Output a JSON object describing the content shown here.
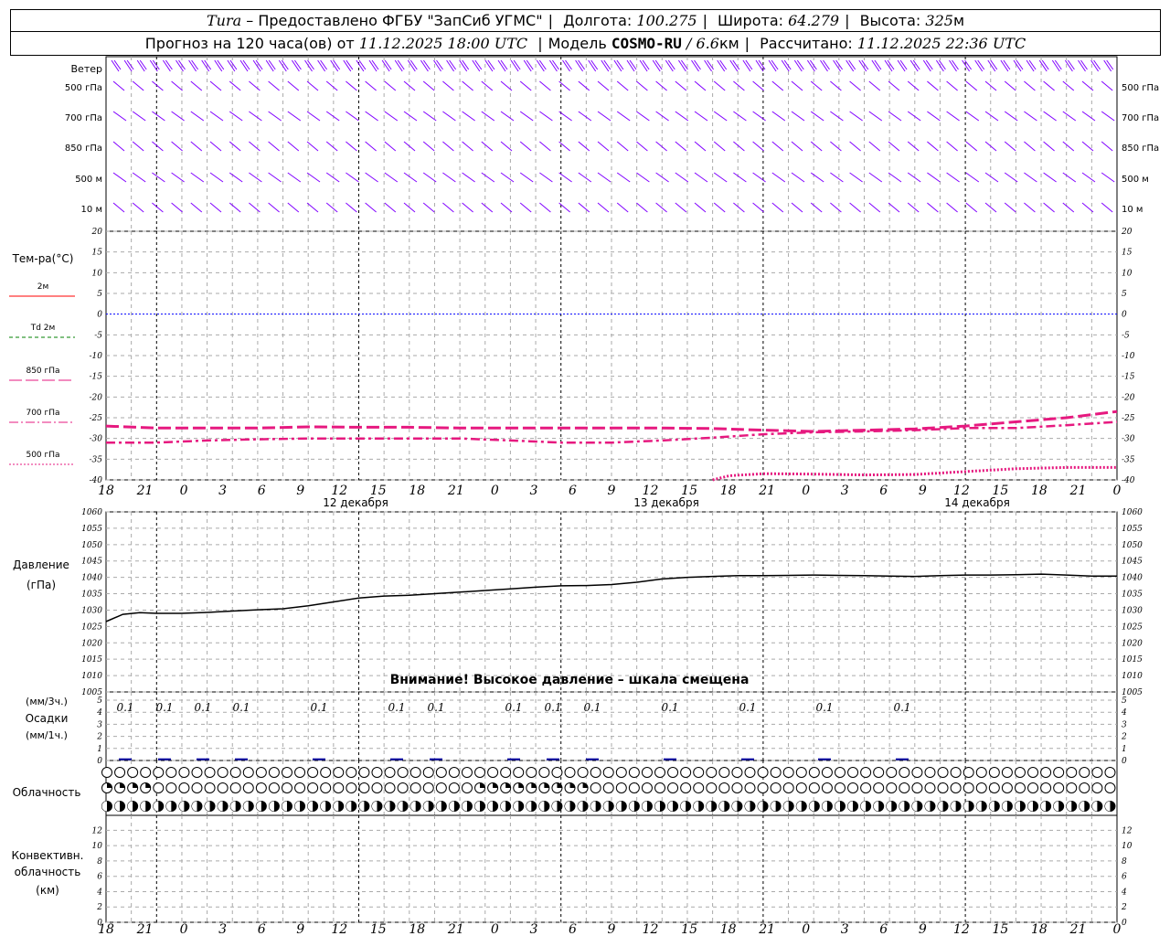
{
  "header": {
    "station": "Tura",
    "provided_by": "– Предоставлено ФГБУ \"ЗапСиб УГМС\"",
    "lon_label": "Долгота:",
    "lon": "100.275",
    "lat_label": "Широта:",
    "lat": "64.279",
    "alt_label": "Высота:",
    "alt": "325",
    "alt_unit": "м",
    "forecast_label": "Прогноз на 120 часа(ов) от",
    "forecast_start": "11.12.2025 18:00 UTC",
    "model_label": "Модель",
    "model": "COSMO-RU",
    "model_res": "/ 6.6",
    "model_res_unit": "км",
    "computed_label": "Рассчитано:",
    "computed": "11.12.2025 22:36 UTC"
  },
  "colors": {
    "t2m": "#ff0000",
    "td2m": "#008000",
    "series_magenta": "#e6197f",
    "wind": "#8000ff",
    "zero_line": "#0000ff",
    "pressure": "#000000",
    "precip": "#0000a0",
    "grid": "#aaaaaa"
  },
  "wind_panel": {
    "title": "Ветер",
    "levels": [
      "500 гПа",
      "700 гПа",
      "850 гПа",
      "500 м",
      "10 м"
    ]
  },
  "time_axis": {
    "ticks": [
      "18",
      "21",
      "0",
      "3",
      "6",
      "9",
      "12",
      "15",
      "18",
      "21",
      "0",
      "3",
      "6",
      "9",
      "12",
      "15",
      "18",
      "21",
      "0",
      "3",
      "6",
      "9",
      "12",
      "15",
      "18",
      "21",
      "0"
    ],
    "day_labels": [
      "12 декабря",
      "13 декабря",
      "14 декабря"
    ]
  },
  "temp_panel": {
    "title": "Тем-ра(°С)",
    "legend": [
      {
        "label": "2м",
        "style": "solid",
        "color": "#ff0000"
      },
      {
        "label": "Td 2м",
        "style": "dashed",
        "color": "#008000"
      },
      {
        "label": "850 гПа",
        "style": "longdash",
        "color": "#e6197f"
      },
      {
        "label": "700 гПа",
        "style": "dashdot",
        "color": "#e6197f"
      },
      {
        "label": "500 гПа",
        "style": "dotted",
        "color": "#e6197f"
      }
    ],
    "yticks": [
      "20",
      "15",
      "10",
      "5",
      "0",
      "-5",
      "-10",
      "-15",
      "-20",
      "-25",
      "-30",
      "-35",
      "-40"
    ]
  },
  "pressure_panel": {
    "title_line1": "Давление",
    "title_line2": "(гПа)",
    "warning": "Внимание! Высокое давление – шкала смещена",
    "yticks": [
      "1060",
      "1055",
      "1050",
      "1045",
      "1040",
      "1035",
      "1030",
      "1025",
      "1020",
      "1015",
      "1010",
      "1005"
    ]
  },
  "precip_panel": {
    "title_line1": "(мм/3ч.)",
    "title_line2": "Осадки",
    "title_line3": "(мм/1ч.)",
    "yticks": [
      "5",
      "4",
      "3",
      "2",
      "1",
      "0"
    ],
    "labels": [
      "0.1",
      "0.1",
      "0.1",
      "0.1",
      "0.1",
      "0.1",
      "0.1",
      "0.1",
      "0.1",
      "0.1",
      "0.1",
      "0.1",
      "0.1",
      "0.1"
    ]
  },
  "cloud_panel": {
    "title": "Облачность"
  },
  "conv_panel": {
    "title_line1": "Конвективн.",
    "title_line2": "облачность",
    "title_line3": "(км)",
    "yticks": [
      "12",
      "10",
      "8",
      "6",
      "4",
      "2",
      "0"
    ]
  },
  "chart_data": [
    {
      "type": "line",
      "title": "Тем-ра(°С)",
      "x_unit": "hours from forecast start",
      "ylim": [
        -40,
        20
      ],
      "series": [
        {
          "name": "850 гПа",
          "x": [
            0,
            6,
            12,
            18,
            24,
            30,
            36,
            42,
            48,
            54,
            60,
            66,
            72,
            78,
            84,
            90,
            96,
            102,
            108,
            114,
            120
          ],
          "values": [
            -27,
            -27.5,
            -27.5,
            -27.5,
            -27.2,
            -27.3,
            -27.3,
            -27.5,
            -27.5,
            -27.5,
            -27.5,
            -27.5,
            -27.6,
            -28,
            -28.3,
            -28,
            -27.7,
            -27,
            -26,
            -25,
            -23.5
          ]
        },
        {
          "name": "700 гПа",
          "x": [
            0,
            6,
            12,
            18,
            24,
            30,
            36,
            42,
            48,
            54,
            60,
            66,
            72,
            78,
            84,
            90,
            96,
            102,
            108,
            114,
            120
          ],
          "values": [
            -31,
            -31,
            -30.5,
            -30.2,
            -30,
            -30,
            -30,
            -30,
            -30.5,
            -31,
            -31,
            -30.5,
            -29.8,
            -29,
            -28.5,
            -28.3,
            -28,
            -27.5,
            -27.5,
            -26.8,
            -26
          ]
        },
        {
          "name": "500 гПа",
          "x": [
            72,
            74,
            78,
            84,
            90,
            96,
            102,
            108,
            114,
            120
          ],
          "values": [
            -40,
            -39,
            -38.5,
            -38.6,
            -38.8,
            -38.7,
            -38,
            -37.3,
            -37,
            -37
          ]
        }
      ]
    },
    {
      "type": "line",
      "title": "Давление (гПа)",
      "x_unit": "hours from forecast start",
      "ylim": [
        1005,
        1060
      ],
      "series": [
        {
          "name": "Давление",
          "x": [
            0,
            2,
            4,
            6,
            9,
            12,
            15,
            18,
            21,
            24,
            27,
            30,
            33,
            36,
            39,
            42,
            45,
            48,
            51,
            54,
            57,
            60,
            63,
            66,
            69,
            72,
            75,
            78,
            81,
            84,
            87,
            90,
            93,
            96,
            99,
            102,
            105,
            108,
            111,
            114,
            117,
            120
          ],
          "values": [
            1026.5,
            1028.7,
            1029.2,
            1029,
            1029,
            1029.3,
            1029.7,
            1030.1,
            1030.4,
            1031.3,
            1032.5,
            1033.7,
            1034.3,
            1034.5,
            1035,
            1035.5,
            1036,
            1036.5,
            1037,
            1037.4,
            1037.5,
            1037.8,
            1038.5,
            1039.5,
            1040,
            1040.3,
            1040.5,
            1040.5,
            1040.6,
            1040.7,
            1040.6,
            1040.5,
            1040.4,
            1040.3,
            1040.5,
            1040.7,
            1040.7,
            1040.8,
            1041,
            1040.7,
            1040.4,
            1040.4
          ]
        }
      ]
    },
    {
      "type": "bar",
      "title": "Осадки",
      "x_unit": "hours from forecast start",
      "ylim": [
        0,
        5
      ],
      "x": [
        1.5,
        4.5,
        7.5,
        10.5,
        16.5,
        25.5,
        28.5,
        37.5,
        40.5,
        43.5,
        52.5,
        61.5,
        70.5,
        79.5
      ],
      "values": [
        0.1,
        0.1,
        0.1,
        0.1,
        0.1,
        0.1,
        0.1,
        0.1,
        0.1,
        0.1,
        0.1,
        0.1,
        0.1,
        0.1
      ]
    }
  ]
}
